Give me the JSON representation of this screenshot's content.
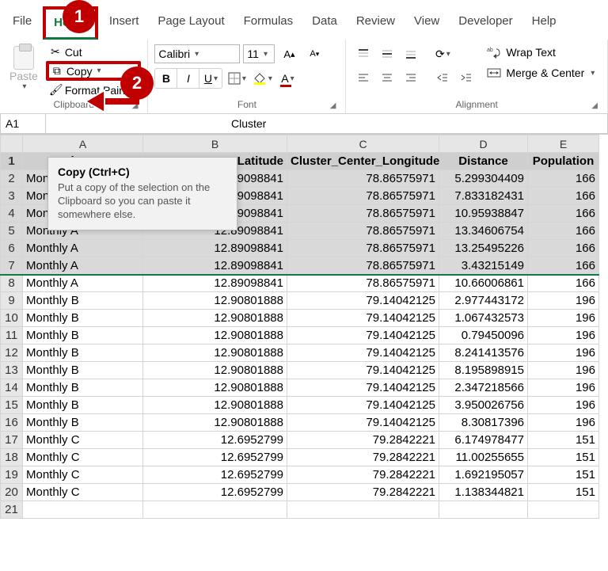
{
  "tabs": [
    "File",
    "Home",
    "Insert",
    "Page Layout",
    "Formulas",
    "Data",
    "Review",
    "View",
    "Developer",
    "Help"
  ],
  "active_tab": "Home",
  "badges": {
    "one": "1",
    "two": "2"
  },
  "clipboard": {
    "paste": "Paste",
    "cut": "Cut",
    "copy": "Copy",
    "format_painter": "Format Painter",
    "group": "Clipboard"
  },
  "font": {
    "name": "Calibri",
    "size": "11",
    "group": "Font"
  },
  "alignment": {
    "wrap": "Wrap Text",
    "merge": "Merge & Center",
    "group": "Alignment"
  },
  "tooltip": {
    "title": "Copy (Ctrl+C)",
    "body": "Put a copy of the selection on the Clipboard so you can paste it somewhere else."
  },
  "name_box": "A1",
  "formula_bar": "Cluster",
  "columns": [
    "A",
    "B",
    "C",
    "D",
    "E"
  ],
  "headers": [
    "Cluster",
    "Cluster_Center_Latitude",
    "Cluster_Center_Longitude",
    "Distance",
    "Population"
  ],
  "header_truncated": "r_Latitude",
  "chart_data": {
    "type": "table",
    "columns": [
      "Cluster",
      "Cluster_Center_Latitude",
      "Cluster_Center_Longitude",
      "Distance",
      "Population"
    ],
    "rows": [
      [
        "Monthly A",
        12.89098841,
        78.86575971,
        5.299304409,
        166
      ],
      [
        "Monthly A",
        12.89098841,
        78.86575971,
        7.833182431,
        166
      ],
      [
        "Monthly A",
        12.89098841,
        78.86575971,
        10.95938847,
        166
      ],
      [
        "Monthly A",
        12.89098841,
        78.86575971,
        13.34606754,
        166
      ],
      [
        "Monthly A",
        12.89098841,
        78.86575971,
        13.25495226,
        166
      ],
      [
        "Monthly A",
        12.89098841,
        78.86575971,
        3.43215149,
        166
      ],
      [
        "Monthly A",
        12.89098841,
        78.86575971,
        10.66006861,
        166
      ],
      [
        "Monthly B",
        12.90801888,
        79.14042125,
        2.977443172,
        196
      ],
      [
        "Monthly B",
        12.90801888,
        79.14042125,
        1.067432573,
        196
      ],
      [
        "Monthly B",
        12.90801888,
        79.14042125,
        0.79450096,
        196
      ],
      [
        "Monthly B",
        12.90801888,
        79.14042125,
        8.241413576,
        196
      ],
      [
        "Monthly B",
        12.90801888,
        79.14042125,
        8.195898915,
        196
      ],
      [
        "Monthly B",
        12.90801888,
        79.14042125,
        2.347218566,
        196
      ],
      [
        "Monthly B",
        12.90801888,
        79.14042125,
        3.950026756,
        196
      ],
      [
        "Monthly B",
        12.90801888,
        79.14042125,
        8.30817396,
        196
      ],
      [
        "Monthly C",
        12.6952799,
        79.2842221,
        6.174978477,
        151
      ],
      [
        "Monthly C",
        12.6952799,
        79.2842221,
        11.00255655,
        151
      ],
      [
        "Monthly C",
        12.6952799,
        79.2842221,
        1.692195057,
        151
      ],
      [
        "Monthly C",
        12.6952799,
        79.2842221,
        1.138344821,
        151
      ]
    ]
  },
  "selected_rows": [
    1,
    2,
    3,
    4,
    5,
    6,
    7
  ]
}
